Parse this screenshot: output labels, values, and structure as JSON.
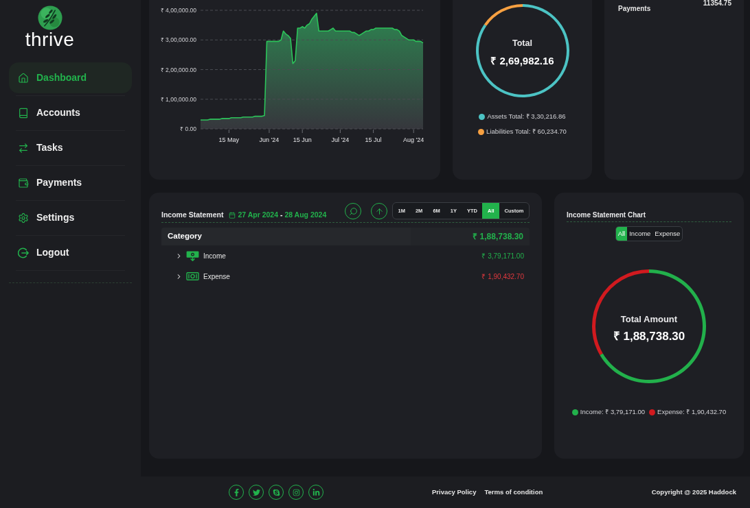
{
  "sidebar": {
    "logo_text": "thrive",
    "items": [
      {
        "label": "Dashboard",
        "selected": true
      },
      {
        "label": "Accounts",
        "selected": false
      },
      {
        "label": "Tasks",
        "selected": false
      },
      {
        "label": "Payments",
        "selected": false
      },
      {
        "label": "Settings",
        "selected": false
      },
      {
        "label": "Logout",
        "selected": false
      }
    ]
  },
  "area_chart": {
    "chart_data": {
      "type": "area",
      "grid": true,
      "categories": [
        null,
        null,
        null,
        null,
        null,
        null,
        null,
        null,
        null,
        null,
        null,
        null,
        "15 May",
        null,
        null,
        null,
        null,
        null,
        null,
        null,
        null,
        null,
        null,
        null,
        null,
        null,
        null,
        null,
        null,
        "Jun '24",
        null,
        null,
        null,
        null,
        null,
        null,
        null,
        null,
        null,
        null,
        null,
        null,
        null,
        "15 Jun",
        null,
        null,
        null,
        null,
        null,
        null,
        null,
        null,
        null,
        null,
        null,
        null,
        null,
        null,
        null,
        "Jul '24",
        null,
        null,
        null,
        null,
        null,
        null,
        null,
        null,
        null,
        null,
        null,
        null,
        null,
        "15 Jul",
        null,
        null,
        null,
        null,
        null,
        null,
        null,
        null,
        null,
        null,
        null,
        null,
        null,
        null,
        null,
        null,
        "Aug '24",
        null,
        null,
        null,
        null
      ],
      "values": [
        30000,
        30000,
        30000,
        30000,
        32500,
        32500,
        32500,
        32500,
        32500,
        35000,
        35000,
        35000,
        35000,
        37500,
        37500,
        37500,
        37500,
        37500,
        40000,
        40000,
        40000,
        40000,
        40000,
        42500,
        42500,
        42500,
        42500,
        45000,
        295000,
        295000,
        295000,
        295000,
        295000,
        295000,
        300000,
        330000,
        320000,
        315000,
        305000,
        220000,
        230000,
        340000,
        340000,
        345000,
        340000,
        350000,
        355000,
        370000,
        380000,
        390000,
        330000,
        330000,
        330000,
        330000,
        330000,
        335000,
        340000,
        330000,
        330000,
        330000,
        330000,
        330000,
        330000,
        330000,
        325000,
        325000,
        320000,
        315000,
        320000,
        325000,
        330000,
        330000,
        335000,
        335000,
        340000,
        340000,
        340000,
        340000,
        340000,
        340000,
        340000,
        340000,
        335000,
        335000,
        330000,
        315000,
        310000,
        305000,
        300000,
        300000,
        300000,
        295000,
        295000,
        295000,
        290000
      ],
      "ylim": [
        0,
        400000
      ],
      "yticks": [
        {
          "value": 0,
          "label": "₹ 0.00"
        },
        {
          "value": 100000,
          "label": "₹ 1,00,000.00"
        },
        {
          "value": 200000,
          "label": "₹ 2,00,000.00"
        },
        {
          "value": 300000,
          "label": "₹ 3,00,000.00"
        },
        {
          "value": 400000,
          "label": "₹ 4,00,000.00"
        }
      ]
    }
  },
  "balance": {
    "title": "Total",
    "amount": "₹ 2,69,982.16",
    "chart_data": {
      "type": "donut",
      "values": [
        84.57,
        15.43
      ]
    },
    "legend": [
      {
        "label": "Assets Total: ₹ 3,30,216.86",
        "color": "#4cc3c4"
      },
      {
        "label": "Liabilities Total: ₹ 60,234.70",
        "color": "#f7a041"
      }
    ]
  },
  "payments": {
    "label": "Payments",
    "value": "11354.75"
  },
  "income_statement": {
    "title": "Income Statement",
    "date_from": "27 Apr 2024",
    "date_separator": "-",
    "date_to": "28 Aug 2024",
    "ranges": [
      {
        "label": "1M",
        "selected": false
      },
      {
        "label": "2M",
        "selected": false
      },
      {
        "label": "6M",
        "selected": false
      },
      {
        "label": "1Y",
        "selected": false
      },
      {
        "label": "YTD",
        "selected": false
      },
      {
        "label": "All",
        "selected": true
      },
      {
        "label": "Custom",
        "selected": false
      }
    ],
    "table": {
      "header": {
        "label": "Category",
        "total": "₹ 1,88,738.30"
      },
      "rows": [
        {
          "kind": "income",
          "label": "Income",
          "amount": "₹ 3,79,171.00",
          "expanded": false
        },
        {
          "kind": "expense",
          "label": "Expense",
          "amount": "₹ 1,90,432.70",
          "expanded": false
        }
      ]
    }
  },
  "income_chart": {
    "title": "Income Statement Chart",
    "filters": [
      {
        "label": "All",
        "selected": true
      },
      {
        "label": "Income",
        "selected": false
      },
      {
        "label": "Expense",
        "selected": false
      }
    ],
    "center_title": "Total Amount",
    "center_amount": "₹ 1,88,738.30",
    "chart_data": {
      "type": "donut",
      "values": [
        66.57,
        33.43
      ]
    },
    "legend": [
      {
        "label": "Income: ₹ 3,79,171.00",
        "color": "#22b04b"
      },
      {
        "label": "Expense: ₹ 1,90,432.70",
        "color": "#d11a1f"
      }
    ]
  },
  "footer": {
    "links": [
      "Privacy Policy",
      "Terms of condition"
    ],
    "copyright": "Copyright @ 2025 Haddock"
  }
}
